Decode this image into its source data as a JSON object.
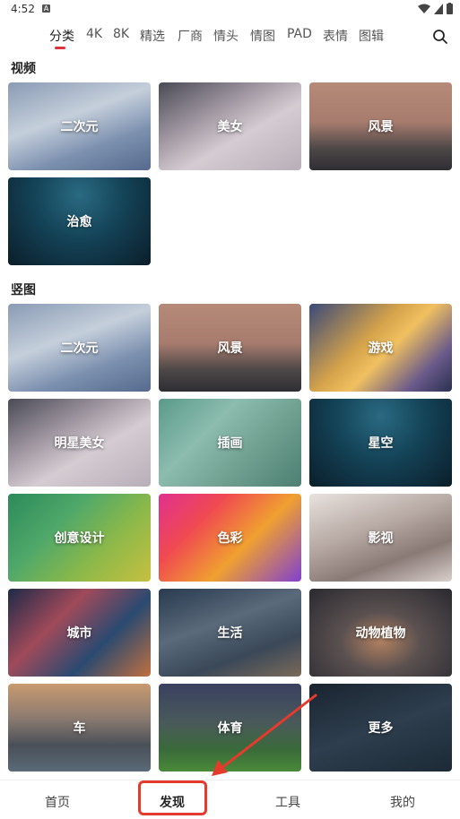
{
  "status": {
    "time": "4:52",
    "notification_badge": "A"
  },
  "tabs": [
    "分类",
    "4K",
    "8K",
    "精选",
    "厂商",
    "情头",
    "情图",
    "PAD",
    "表情",
    "图辑"
  ],
  "active_tab": "分类",
  "sections": [
    {
      "title": "视频",
      "items": [
        "二次元",
        "美女",
        "风景",
        "治愈"
      ]
    },
    {
      "title": "竖图",
      "items": [
        "二次元",
        "风景",
        "游戏",
        "明星美女",
        "插画",
        "星空",
        "创意设计",
        "色彩",
        "影视",
        "城市",
        "生活",
        "动物植物",
        "车",
        "体育",
        "更多"
      ]
    }
  ],
  "bottom_nav": [
    "首页",
    "发现",
    "工具",
    "我的"
  ],
  "active_nav": "发现",
  "colors": {
    "accent": "#e0303b",
    "annotation": "#e43b2c"
  },
  "icons": [
    "search-icon",
    "wifi-icon",
    "signal-icon",
    "battery-icon"
  ]
}
